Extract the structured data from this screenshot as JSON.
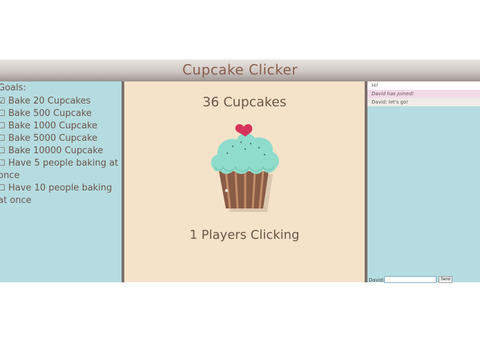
{
  "app": {
    "title": "Cupcake Clicker"
  },
  "goals": {
    "heading": "Goals:",
    "items": [
      {
        "label": "Bake 20 Cupcakes",
        "done": true,
        "mark": "☑"
      },
      {
        "label": "Bake 500 Cupcake",
        "done": false,
        "mark": "☐"
      },
      {
        "label": "Bake 1000 Cupcake",
        "done": false,
        "mark": "☐"
      },
      {
        "label": "Bake 5000 Cupcake",
        "done": false,
        "mark": "☐"
      },
      {
        "label": "Bake 10000 Cupcake",
        "done": false,
        "mark": "☐"
      },
      {
        "label": "Have 5 people baking at once",
        "done": false,
        "mark": "☐"
      },
      {
        "label": "Have 10 people baking at once",
        "done": false,
        "mark": "☐"
      }
    ]
  },
  "main": {
    "cupcake_count": "36 Cupcakes",
    "players_text": "1 Players Clicking"
  },
  "chat": {
    "messages": [
      "Hi!",
      "David has joined!",
      "David: let's go!"
    ],
    "name_label": "David:",
    "input_value": "",
    "send_label": "Send"
  },
  "colors": {
    "side_panels": "#b5dce1",
    "main_panel": "#f5e3c9",
    "text": "#6d5548",
    "frosting": "#8fdccc",
    "heart": "#d6335c",
    "wrapper": "#8a5c45"
  }
}
